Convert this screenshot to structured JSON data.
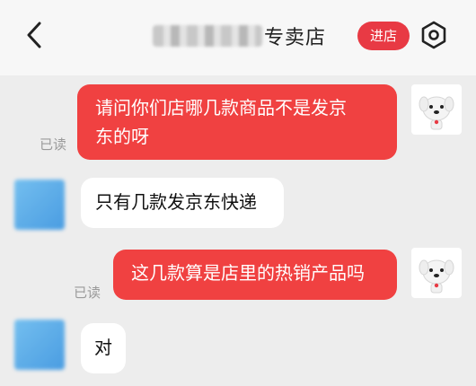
{
  "header": {
    "shop_name_suffix": "专卖店",
    "enter_store_label": "进店"
  },
  "messages": [
    {
      "side": "right",
      "text_line1": "请问你们店哪几款商品不是发京",
      "text_line2": "东的呀",
      "status": "已读"
    },
    {
      "side": "left",
      "text": "只有几款发京东快递"
    },
    {
      "side": "right",
      "text": "这几款算是店里的热销产品吗",
      "status": "已读"
    },
    {
      "side": "left",
      "text": "对"
    }
  ],
  "colors": {
    "accent_red": "#f04141",
    "enter_button": "#e83a44",
    "background": "#ededed"
  },
  "icons": {
    "back": "chevron-left-icon",
    "settings": "hexagon-settings-icon"
  }
}
